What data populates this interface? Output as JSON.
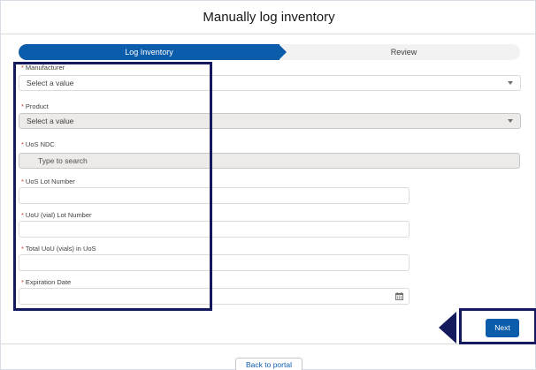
{
  "modal": {
    "title": "Manually log inventory"
  },
  "path": {
    "steps": [
      {
        "label": "Log Inventory",
        "active": true
      },
      {
        "label": "Review",
        "active": false
      }
    ]
  },
  "form": {
    "manufacturer": {
      "label": "Manufacturer",
      "required_mark": "*",
      "value": "Select a value"
    },
    "product": {
      "label": "Product",
      "required_mark": "*",
      "value": "Select a value",
      "disabled": true
    },
    "uos_ndc": {
      "label": "UoS NDC",
      "required_mark": "*",
      "placeholder": "Type to search",
      "disabled": true
    },
    "uos_lot_number": {
      "label": "UoS Lot Number",
      "required_mark": "*",
      "value": ""
    },
    "uou_lot_number": {
      "label": "UoU (vial) Lot Number",
      "required_mark": "*",
      "value": ""
    },
    "total_uou": {
      "label": "Total UoU (vials) in UoS",
      "required_mark": "*",
      "value": ""
    },
    "expiration_date": {
      "label": "Expiration Date",
      "required_mark": "*",
      "value": "",
      "icon": "calendar-icon"
    }
  },
  "footer": {
    "next_label": "Next",
    "back_label": "Back to portal"
  },
  "colors": {
    "brand": "#0b5cab",
    "annotation": "#15195e",
    "required": "#c23934"
  }
}
